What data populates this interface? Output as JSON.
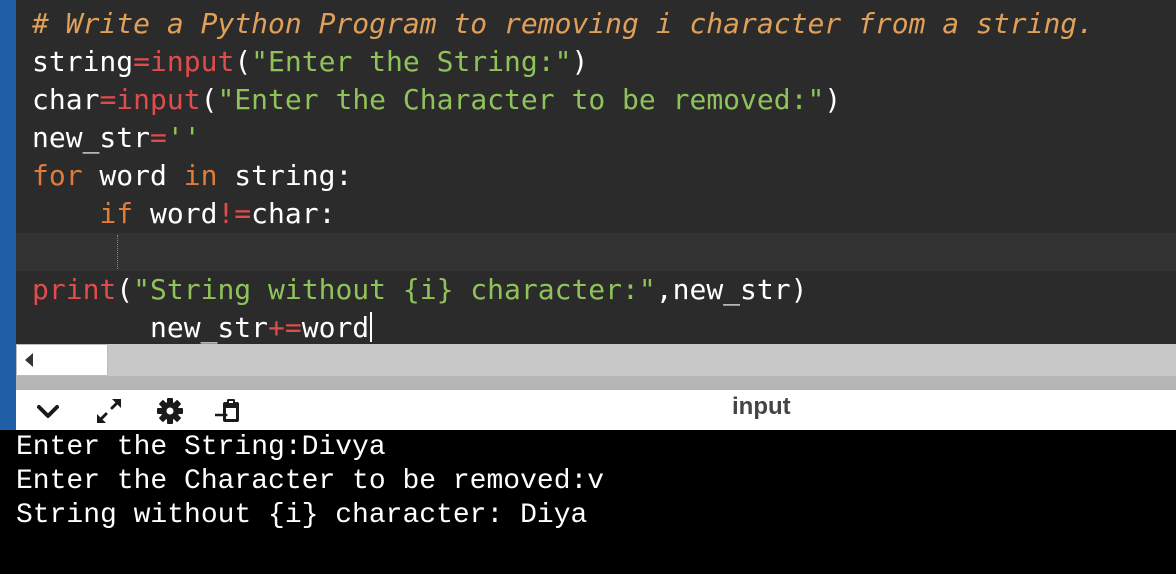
{
  "editor": {
    "lines": [
      {
        "tokens": [
          {
            "t": "# Write a Python Program to removing i character from a string.",
            "k": "comment"
          }
        ]
      },
      {
        "tokens": [
          {
            "t": "string",
            "k": "name"
          },
          {
            "t": "=",
            "k": "op"
          },
          {
            "t": "input",
            "k": "builtin"
          },
          {
            "t": "(",
            "k": "name"
          },
          {
            "t": "\"Enter the String:\"",
            "k": "str"
          },
          {
            "t": ")",
            "k": "name"
          }
        ]
      },
      {
        "tokens": [
          {
            "t": "char",
            "k": "name"
          },
          {
            "t": "=",
            "k": "op"
          },
          {
            "t": "input",
            "k": "builtin"
          },
          {
            "t": "(",
            "k": "name"
          },
          {
            "t": "\"Enter the Character to be removed:\"",
            "k": "str"
          },
          {
            "t": ")",
            "k": "name"
          }
        ]
      },
      {
        "tokens": [
          {
            "t": "new_str",
            "k": "name"
          },
          {
            "t": "=",
            "k": "op"
          },
          {
            "t": "''",
            "k": "str"
          }
        ]
      },
      {
        "tokens": [
          {
            "t": "for",
            "k": "kw"
          },
          {
            "t": " word ",
            "k": "name"
          },
          {
            "t": "in",
            "k": "kw"
          },
          {
            "t": " string:",
            "k": "name"
          }
        ]
      },
      {
        "tokens": [
          {
            "t": "    ",
            "k": "name"
          },
          {
            "t": "if",
            "k": "kw"
          },
          {
            "t": " word",
            "k": "name"
          },
          {
            "t": "!=",
            "k": "op"
          },
          {
            "t": "char:",
            "k": "name"
          }
        ]
      },
      {
        "tokens": [
          {
            "t": "     new_str",
            "k": "name"
          },
          {
            "t": "+=",
            "k": "op"
          },
          {
            "t": "word",
            "k": "name"
          }
        ],
        "current": true
      },
      {
        "tokens": [
          {
            "t": "print",
            "k": "builtin"
          },
          {
            "t": "(",
            "k": "name"
          },
          {
            "t": "\"String without {i} character:\"",
            "k": "str"
          },
          {
            "t": ",new_str)",
            "k": "name"
          }
        ]
      }
    ]
  },
  "toolbar": {
    "title": "input",
    "buttons": [
      {
        "name": "collapse-chevron-icon"
      },
      {
        "name": "expand-arrows-icon"
      },
      {
        "name": "gear-icon"
      },
      {
        "name": "clipboard-paste-icon"
      }
    ]
  },
  "console": {
    "lines": [
      "Enter the String:Divya",
      "Enter the Character to be removed:v",
      "String without {i} character: Diya"
    ]
  },
  "colors": {
    "editor_bg": "#2b2b2b",
    "comment": "#e0a05a",
    "keyword": "#e07b3a",
    "builtin": "#e04b4b",
    "string": "#8fc35a",
    "console_bg": "#000000",
    "accent_strip": "#1e5fa8"
  }
}
